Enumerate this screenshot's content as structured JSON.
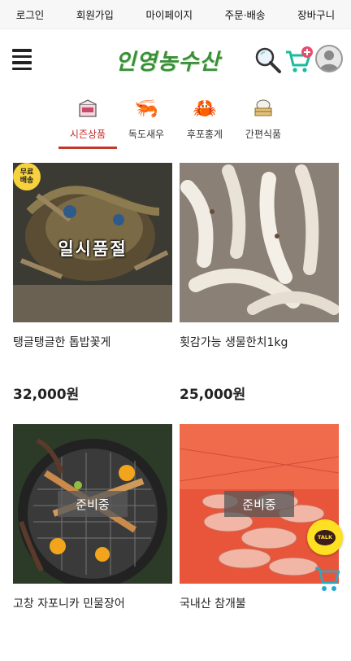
{
  "topnav": {
    "login": "로그인",
    "signup": "회원가입",
    "mypage": "마이페이지",
    "order": "주문·배송",
    "cart": "장바구니"
  },
  "logo": {
    "text": "인영농수산"
  },
  "categories": [
    {
      "label": "시즌상품",
      "icon": "new-box-icon"
    },
    {
      "label": "독도새우",
      "icon": "shrimp-icon"
    },
    {
      "label": "후포홍게",
      "icon": "crab-icon"
    },
    {
      "label": "간편식품",
      "icon": "steamed-bun-icon"
    }
  ],
  "products": [
    {
      "name": "탱글탱글한 톱밥꽃게",
      "price": "32,000원",
      "badge": "무료배송",
      "overlay": "일시품절"
    },
    {
      "name": "횟감가능 생물한치1kg",
      "price": "25,000원"
    },
    {
      "name": "고창 자포니카 민물장어",
      "overlay": "준비중"
    },
    {
      "name": "국내산 참개불",
      "overlay": "준비중"
    }
  ],
  "floating": {
    "talk_label": "TALK"
  },
  "colors": {
    "accent_red": "#c0392b",
    "logo_green": "#3a8f3a",
    "talk_yellow": "#fde021",
    "cart_teal": "#1abc9c"
  }
}
